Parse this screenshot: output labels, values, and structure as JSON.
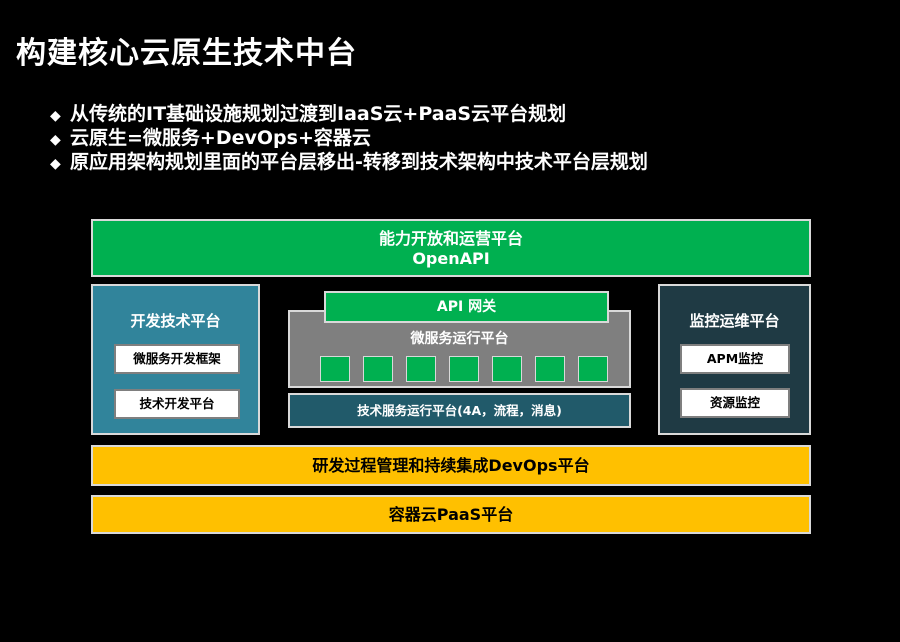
{
  "title": "构建核心云原生技术中台",
  "bullets": [
    "从传统的IT基础设施规划过渡到IaaS云+PaaS云平台规划",
    "云原生=微服务+DevOps+容器云",
    "原应用架构规划里面的平台层移出-转移到技术架构中技术平台层规划"
  ],
  "diagram": {
    "top": {
      "line1": "能力开放和运营平台",
      "line2": "OpenAPI"
    },
    "left": {
      "title": "开发技术平台",
      "items": [
        "微服务开发框架",
        "技术开发平台"
      ]
    },
    "center": {
      "gateway": "API 网关",
      "runtime": "微服务运行平台",
      "service_count": 7,
      "tech_runtime": "技术服务运行平台(4A，流程，消息)"
    },
    "right": {
      "title": "监控运维平台",
      "items": [
        "APM监控",
        "资源监控"
      ]
    },
    "devops": "研发过程管理和持续集成DevOps平台",
    "paas": "容器云PaaS平台"
  },
  "colors": {
    "green": "#00b050",
    "blue": "#31849b",
    "navy": "#1f3a44",
    "grey": "#7f7f7f",
    "yellow": "#ffc000"
  }
}
